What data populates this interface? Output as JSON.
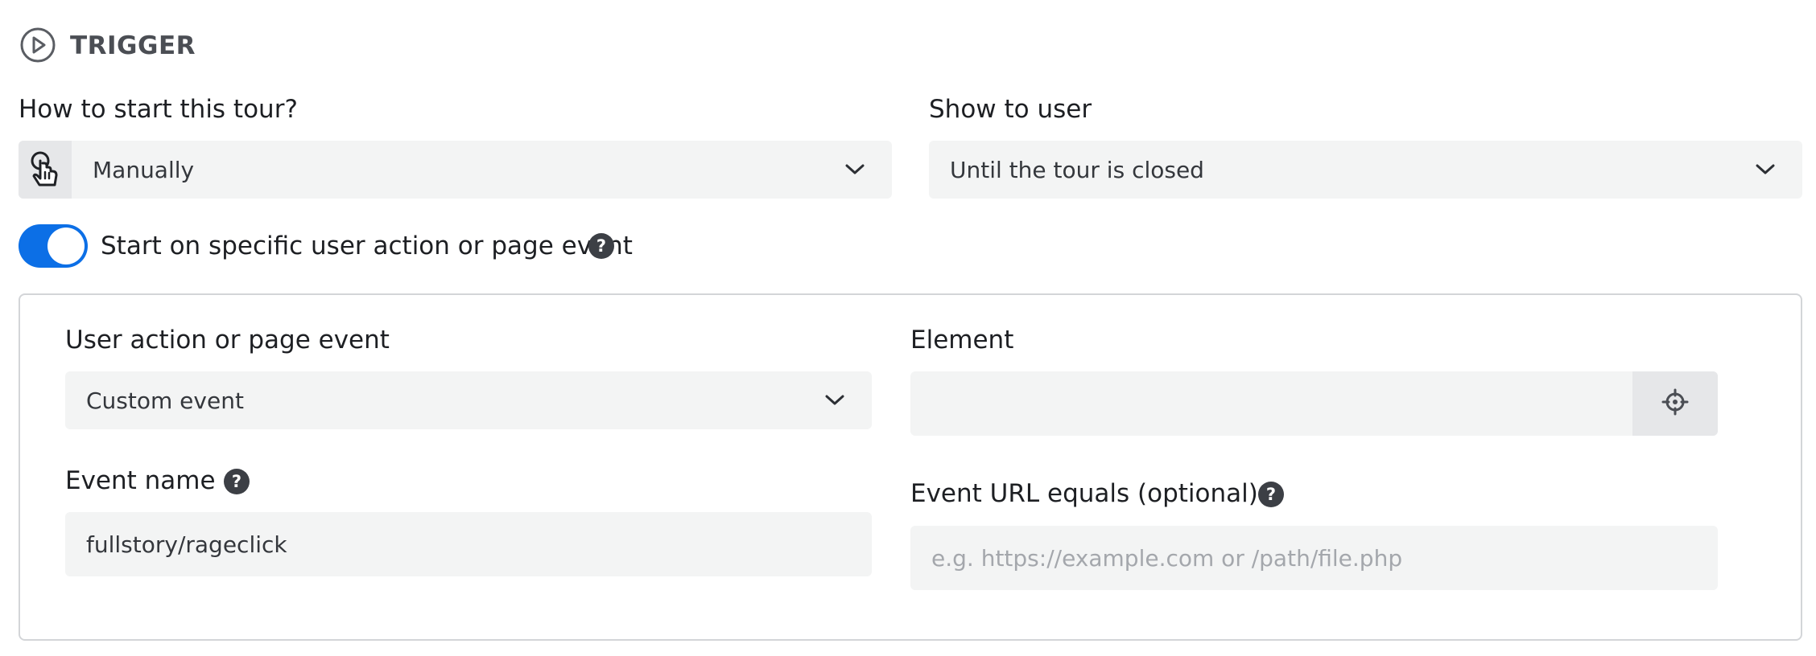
{
  "section": {
    "title": "TRIGGER",
    "icon": "play-circle-icon"
  },
  "trigger": {
    "label": "How to start this tour?",
    "icon": "pointer-hand-icon",
    "selected": "Manually"
  },
  "show": {
    "label": "Show to user",
    "selected": "Until the tour is closed"
  },
  "toggle": {
    "label": "Start on specific user action or page event",
    "checked": true,
    "help_icon": "?"
  },
  "panel": {
    "event": {
      "label": "User action or page event",
      "selected": "Custom event"
    },
    "element": {
      "label": "Element",
      "value": "",
      "picker_icon": "crosshair-icon"
    },
    "event_name": {
      "label": "Event name",
      "value": "fullstory/rageclick",
      "help_icon": "?"
    },
    "event_url": {
      "label": "Event URL equals (optional)",
      "placeholder": "e.g. https://example.com or /path/file.php",
      "help_icon": "?"
    }
  },
  "colors": {
    "accent": "#0c6fe6",
    "field_bg": "#f3f4f4",
    "prefix_bg": "#e6e7e9",
    "help_bg": "#3c3f45"
  }
}
